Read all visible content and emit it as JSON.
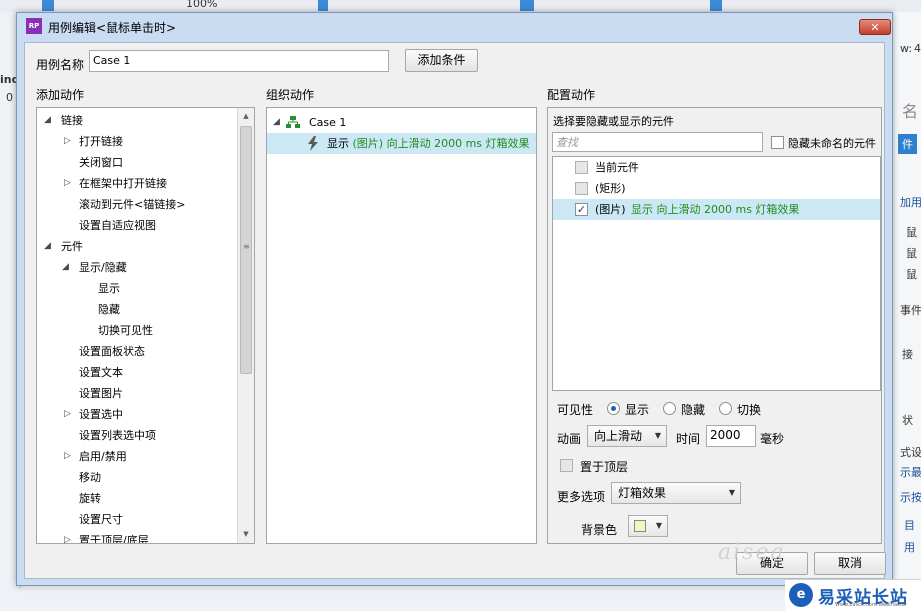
{
  "background": {
    "fragments": [
      "100%",
      "ind",
      "0",
      "w:",
      "4",
      "名",
      "件",
      "加用",
      "鼠",
      "鼠",
      "鼠",
      "事件",
      "接",
      "状",
      "式设",
      "示最",
      "示按",
      "目",
      "用"
    ]
  },
  "dialog": {
    "title": "用例编辑<鼠标单击时>",
    "close_icon": "✕",
    "case_name_label": "用例名称",
    "case_name_value": "Case 1",
    "add_condition_button": "添加条件",
    "add_action": {
      "header": "添加动作",
      "items": [
        {
          "label": "链接",
          "arrow": "◢"
        },
        {
          "label": "打开链接",
          "arrow": "▷"
        },
        {
          "label": "关闭窗口",
          "arrow": ""
        },
        {
          "label": "在框架中打开链接",
          "arrow": "▷"
        },
        {
          "label": "滚动到元件<锚链接>",
          "arrow": ""
        },
        {
          "label": "设置自适应视图",
          "arrow": ""
        },
        {
          "label": "元件",
          "arrow": "◢"
        },
        {
          "label": "显示/隐藏",
          "arrow": "◢"
        },
        {
          "label": "显示",
          "arrow": ""
        },
        {
          "label": "隐藏",
          "arrow": ""
        },
        {
          "label": "切换可见性",
          "arrow": ""
        },
        {
          "label": "设置面板状态",
          "arrow": ""
        },
        {
          "label": "设置文本",
          "arrow": ""
        },
        {
          "label": "设置图片",
          "arrow": ""
        },
        {
          "label": "设置选中",
          "arrow": "▷"
        },
        {
          "label": "设置列表选中项",
          "arrow": ""
        },
        {
          "label": "启用/禁用",
          "arrow": "▷"
        },
        {
          "label": "移动",
          "arrow": ""
        },
        {
          "label": "旋转",
          "arrow": ""
        },
        {
          "label": "设置尺寸",
          "arrow": ""
        },
        {
          "label": "置于顶层/底层",
          "arrow": "▷"
        }
      ]
    },
    "organize_action": {
      "header": "组织动作",
      "case_label": "Case 1",
      "action_prefix": "显示",
      "action_detail": "(图片) 向上滑动 2000 ms 灯箱效果"
    },
    "configure_action": {
      "header": "配置动作",
      "subtitle": "选择要隐藏或显示的元件",
      "search_placeholder": "查找",
      "hide_unnamed_label": "隐藏未命名的元件",
      "widgets": [
        {
          "label": "当前元件",
          "detail": "",
          "checked": false
        },
        {
          "label": "(矩形)",
          "detail": "",
          "checked": false
        },
        {
          "label": "(图片)",
          "detail": "显示 向上滑动 2000 ms 灯箱效果",
          "checked": true
        }
      ],
      "visibility_label": "可见性",
      "visibility_options": [
        "显示",
        "隐藏",
        "切换"
      ],
      "visibility_selected": "显示",
      "animation_label": "动画",
      "animation_value": "向上滑动",
      "time_label": "时间",
      "time_value": "2000",
      "time_unit": "毫秒",
      "bring_to_front_label": "置于顶层",
      "more_options_label": "更多选项",
      "more_options_value": "灯箱效果",
      "bg_color_label": "背景色",
      "bg_color": "#f4f4c4"
    },
    "ok_button": "确定",
    "cancel_button": "取消"
  },
  "watermark": {
    "text": "aisea",
    "logo_text": "易采站长站",
    "logo_sub": "Www.Easck.Com Webmaster"
  },
  "colors": {
    "dialog_frame": "#c9dcf1",
    "selection": "#cce8f5",
    "green_text": "#1e8c1e",
    "radio_dot": "#1d62b5"
  }
}
